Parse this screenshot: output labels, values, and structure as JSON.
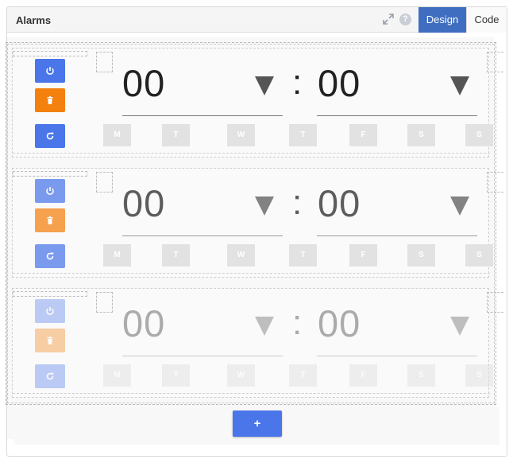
{
  "header": {
    "title": "Alarms",
    "help_glyph": "?",
    "tabs": {
      "design": "Design",
      "code": "Code"
    },
    "active_tab": "Design",
    "accent": "#3f6ec0"
  },
  "alarms": [
    {
      "hour": "00",
      "minute": "00",
      "separator": ":",
      "days": [
        "M",
        "T",
        "W",
        "T",
        "F",
        "S",
        "S"
      ]
    },
    {
      "hour": "00",
      "minute": "00",
      "separator": ":",
      "days": [
        "M",
        "T",
        "W",
        "T",
        "F",
        "S",
        "S"
      ]
    },
    {
      "hour": "00",
      "minute": "00",
      "separator": ":",
      "days": [
        "M",
        "T",
        "W",
        "T",
        "F",
        "S",
        "S"
      ]
    }
  ],
  "icons": {
    "power": "power-icon",
    "delete": "trash-icon",
    "repeat": "refresh-icon",
    "expand": "expand-icon",
    "help": "help-icon"
  },
  "colors": {
    "primary": "#4a76ea",
    "danger": "#f4800d",
    "day_bg": "#e2e2e2"
  },
  "add_button": {
    "label": "+"
  }
}
